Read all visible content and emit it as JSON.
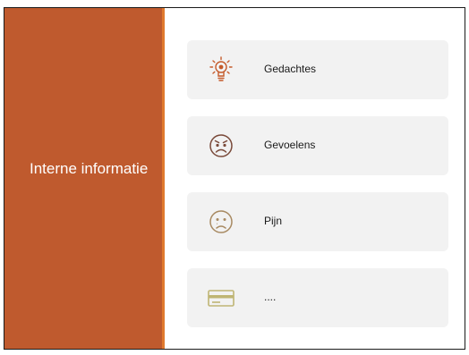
{
  "slide": {
    "side_title": "Interne informatie",
    "colors": {
      "side_panel": "#bf5a2e",
      "accent": "#e07a2e",
      "card_background": "#f2f2f2"
    }
  },
  "items": [
    {
      "label": "Gedachtes",
      "icon": "lightbulb-icon",
      "icon_color": "#c55a2a"
    },
    {
      "label": "Gevoelens",
      "icon": "angry-face-icon",
      "icon_color": "#7a4a3a"
    },
    {
      "label": "Pijn",
      "icon": "sad-face-icon",
      "icon_color": "#a88a62"
    },
    {
      "label": "....",
      "icon": "card-icon",
      "icon_color": "#bfb574"
    }
  ]
}
